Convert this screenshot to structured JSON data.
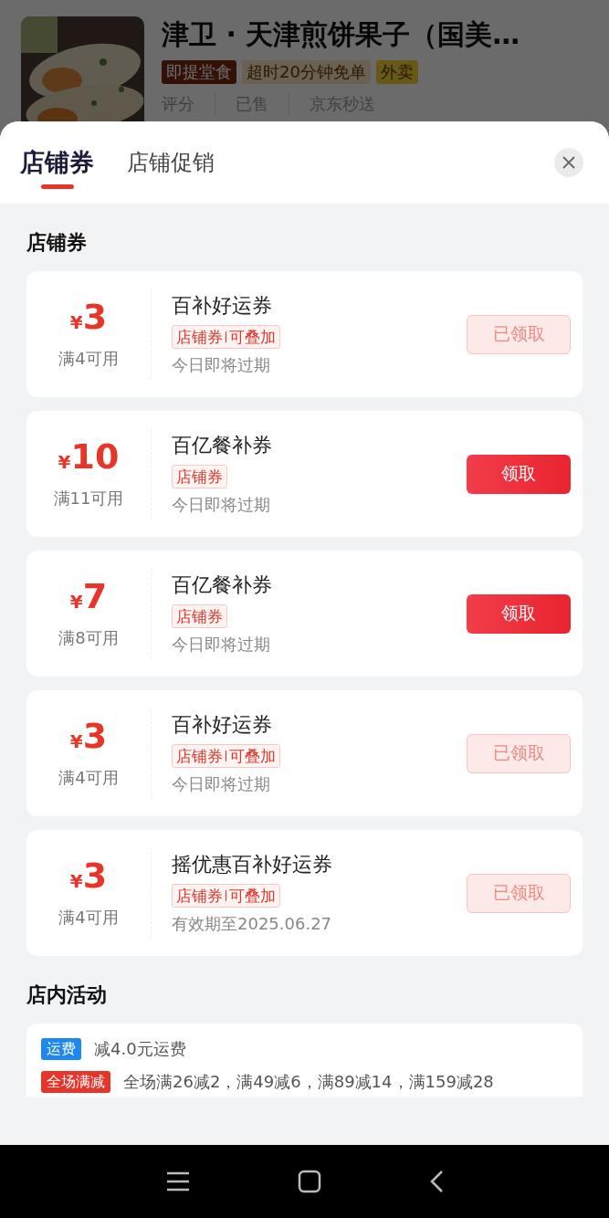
{
  "store": {
    "name": "津卫 · 天津煎饼果子（国美…",
    "tags": [
      {
        "label": "即提堂食",
        "kind": "dine"
      },
      {
        "label": "超时20分钟免单",
        "kind": "guarantee"
      },
      {
        "label": "外卖",
        "kind": "delivery"
      }
    ],
    "stats": [
      "评分",
      "已售",
      "京东秒送"
    ]
  },
  "tabs": [
    {
      "label": "店铺券",
      "selected": true
    },
    {
      "label": "店铺促销",
      "selected": false
    }
  ],
  "coupon_section": "店铺券",
  "coupons": [
    {
      "amount": "3",
      "currency": "¥",
      "condition": "满4可用",
      "title": "百补好运券",
      "tags": [
        "店铺券",
        "可叠加"
      ],
      "expiry": "今日即将过期",
      "button": "已领取",
      "claimed": true
    },
    {
      "amount": "10",
      "currency": "¥",
      "condition": "满11可用",
      "title": "百亿餐补券",
      "tags": [
        "店铺券"
      ],
      "expiry": "今日即将过期",
      "button": "领取",
      "claimed": false
    },
    {
      "amount": "7",
      "currency": "¥",
      "condition": "满8可用",
      "title": "百亿餐补券",
      "tags": [
        "店铺券"
      ],
      "expiry": "今日即将过期",
      "button": "领取",
      "claimed": false
    },
    {
      "amount": "3",
      "currency": "¥",
      "condition": "满4可用",
      "title": "百补好运券",
      "tags": [
        "店铺券",
        "可叠加"
      ],
      "expiry": "今日即将过期",
      "button": "已领取",
      "claimed": true
    },
    {
      "amount": "3",
      "currency": "¥",
      "condition": "满4可用",
      "title": "摇优惠百补好运券",
      "tags": [
        "店铺券",
        "可叠加"
      ],
      "expiry": "有效期至2025.06.27",
      "button": "已领取",
      "claimed": true
    }
  ],
  "activity_section": "店内活动",
  "activities": [
    {
      "badge": "运费",
      "color": "#1e88f0",
      "text": "减4.0元运费"
    },
    {
      "badge": "全场满减",
      "color": "#e8352a",
      "text": "全场满26减2，满49减6，满89减14，满159减28"
    }
  ]
}
